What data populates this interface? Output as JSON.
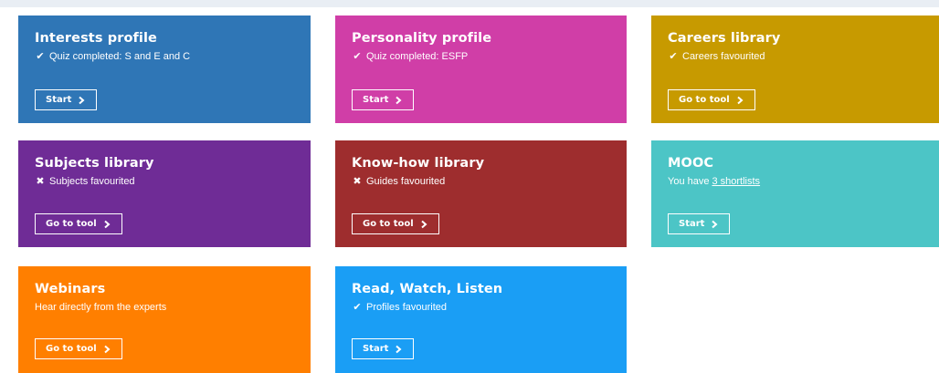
{
  "tiles": [
    {
      "id": "interests",
      "title": "Interests profile",
      "status_icon": "check-icon",
      "status": "Quiz completed: S and E and C",
      "button": "Start",
      "color": "#2f76b6"
    },
    {
      "id": "personality",
      "title": "Personality profile",
      "status_icon": "check-icon",
      "status": "Quiz completed: ESFP",
      "button": "Start",
      "color": "#d03ea7"
    },
    {
      "id": "careers",
      "title": "Careers library",
      "status_icon": "check-icon",
      "status": "Careers favourited",
      "button": "Go to tool",
      "color": "#c79a00"
    },
    {
      "id": "subjects",
      "title": "Subjects library",
      "status_icon": "cross-icon",
      "status": "Subjects favourited",
      "button": "Go to tool",
      "color": "#6f2c96"
    },
    {
      "id": "knowhow",
      "title": "Know-how library",
      "status_icon": "cross-icon",
      "status": "Guides favourited",
      "button": "Go to tool",
      "color": "#9e2d2e"
    },
    {
      "id": "mooc",
      "title": "MOOC",
      "status_prefix": "You have",
      "status_link": "3 shortlists",
      "button": "Start",
      "color": "#4cc5c6"
    },
    {
      "id": "webinars",
      "title": "Webinars",
      "status": "Hear directly from the experts",
      "button": "Go to tool",
      "color": "#ff7f00"
    },
    {
      "id": "rwl",
      "title": "Read, Watch, Listen",
      "status_icon": "check-icon",
      "status": "Profiles favourited",
      "button": "Start",
      "color": "#1a9ef5"
    }
  ]
}
